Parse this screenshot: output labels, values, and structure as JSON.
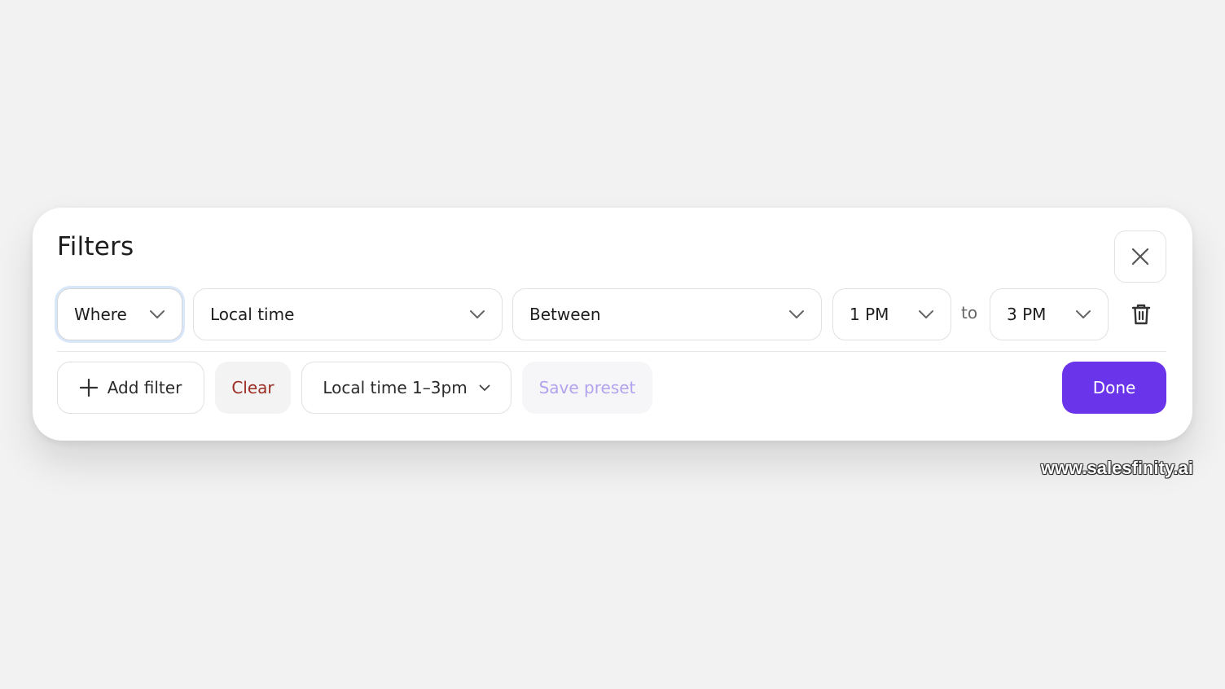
{
  "dialog": {
    "title": "Filters",
    "close_icon": "close-icon"
  },
  "filter_row": {
    "conjunction": "Where",
    "field": "Local time",
    "operator": "Between",
    "from_value": "1 PM",
    "separator": "to",
    "to_value": "3 PM",
    "delete_icon": "trash-icon"
  },
  "footer": {
    "add_filter_label": "Add filter",
    "clear_label": "Clear",
    "preset_label": "Local time 1–3pm",
    "save_preset_label": "Save preset",
    "done_label": "Done"
  },
  "watermark": "www.salesfinity.ai",
  "colors": {
    "accent": "#6a35ea",
    "danger_text": "#9b2c22",
    "disabled_text": "#b3a2ee",
    "focus_ring": "#d9e7fb"
  }
}
